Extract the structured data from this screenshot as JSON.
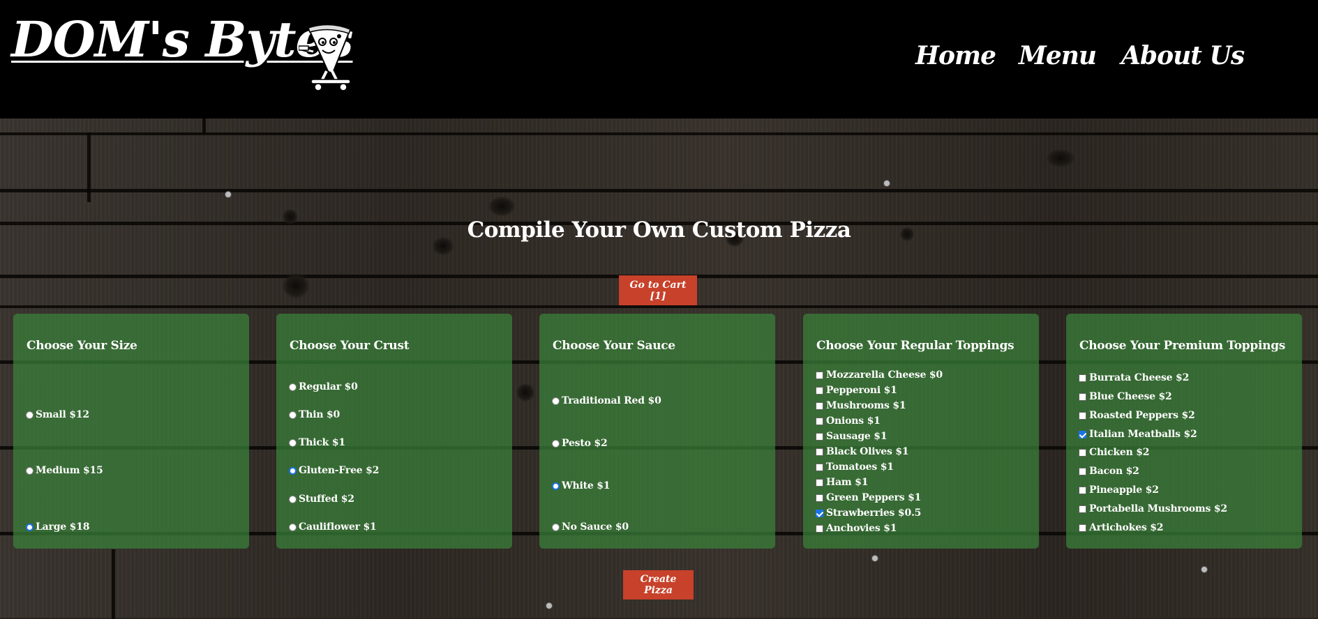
{
  "header": {
    "logo": "DOM's Bytes",
    "nav": [
      {
        "label": "Home"
      },
      {
        "label": "Menu"
      },
      {
        "label": "About Us"
      }
    ]
  },
  "main": {
    "title": "Compile Your Own Custom Pizza",
    "cart_button": "Go to Cart [1]",
    "create_button": "Create Pizza"
  },
  "size": {
    "heading": "Choose Your Size",
    "options": [
      {
        "label": "Small $12",
        "selected": false
      },
      {
        "label": "Medium $15",
        "selected": false
      },
      {
        "label": "Large $18",
        "selected": true
      }
    ]
  },
  "crust": {
    "heading": "Choose Your Crust",
    "options": [
      {
        "label": "Regular $0",
        "selected": false
      },
      {
        "label": "Thin $0",
        "selected": false
      },
      {
        "label": "Thick $1",
        "selected": false
      },
      {
        "label": "Gluten-Free $2",
        "selected": true
      },
      {
        "label": "Stuffed $2",
        "selected": false
      },
      {
        "label": "Cauliflower $1",
        "selected": false
      }
    ]
  },
  "sauce": {
    "heading": "Choose Your Sauce",
    "options": [
      {
        "label": "Traditional Red $0",
        "selected": false
      },
      {
        "label": "Pesto $2",
        "selected": false
      },
      {
        "label": "White $1",
        "selected": true
      },
      {
        "label": "No Sauce $0",
        "selected": false
      }
    ]
  },
  "regular": {
    "heading": "Choose Your Regular Toppings",
    "options": [
      {
        "label": "Mozzarella Cheese $0",
        "checked": false
      },
      {
        "label": "Pepperoni $1",
        "checked": false
      },
      {
        "label": "Mushrooms $1",
        "checked": false
      },
      {
        "label": "Onions $1",
        "checked": false
      },
      {
        "label": "Sausage $1",
        "checked": false
      },
      {
        "label": "Black Olives $1",
        "checked": false
      },
      {
        "label": "Tomatoes $1",
        "checked": false
      },
      {
        "label": "Ham $1",
        "checked": false
      },
      {
        "label": "Green Peppers $1",
        "checked": false
      },
      {
        "label": "Strawberries $0.5",
        "checked": true
      },
      {
        "label": "Anchovies $1",
        "checked": false
      }
    ]
  },
  "premium": {
    "heading": "Choose Your Premium Toppings",
    "options": [
      {
        "label": "Burrata Cheese $2",
        "checked": false
      },
      {
        "label": "Blue Cheese $2",
        "checked": false
      },
      {
        "label": "Roasted Peppers $2",
        "checked": false
      },
      {
        "label": "Italian Meatballs $2",
        "checked": true
      },
      {
        "label": "Chicken $2",
        "checked": false
      },
      {
        "label": "Bacon $2",
        "checked": false
      },
      {
        "label": "Pineapple $2",
        "checked": false
      },
      {
        "label": "Portabella Mushrooms $2",
        "checked": false
      },
      {
        "label": "Artichokes $2",
        "checked": false
      }
    ]
  },
  "colors": {
    "accent_button": "#c8412a",
    "panel_green": "#3a823a",
    "header_bg": "#000000"
  }
}
